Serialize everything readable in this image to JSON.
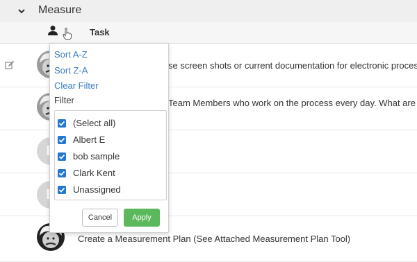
{
  "section": {
    "title": "Measure"
  },
  "column_header": {
    "task_label": "Task"
  },
  "rows": [
    {
      "text": "se screen shots or current documentation for electronic processes)"
    },
    {
      "text": "Team Members who work on the process every day. What are the"
    },
    {
      "avatar_initial": "E"
    },
    {
      "avatar_initial": "E"
    },
    {
      "text": "Create a Measurement Plan (See Attached Measurement Plan Tool)"
    }
  ],
  "dropdown": {
    "sort_az": "Sort A-Z",
    "sort_za": "Sort Z-A",
    "clear_filter": "Clear Filter",
    "filter_label": "Filter",
    "options": [
      {
        "label": "(Select all)",
        "checked": true
      },
      {
        "label": "Albert E",
        "checked": true
      },
      {
        "label": "bob sample",
        "checked": true
      },
      {
        "label": "Clark Kent",
        "checked": true
      },
      {
        "label": "Unassigned",
        "checked": true
      }
    ],
    "cancel_label": "Cancel",
    "apply_label": "Apply"
  },
  "colors": {
    "link": "#3a7bc0",
    "checkbox": "#2577d0",
    "apply_button": "#5cb85c",
    "header_bg": "#efefef"
  },
  "icons": [
    "chevron-down-icon",
    "person-icon",
    "hand-pointer-icon",
    "edit-icon"
  ]
}
